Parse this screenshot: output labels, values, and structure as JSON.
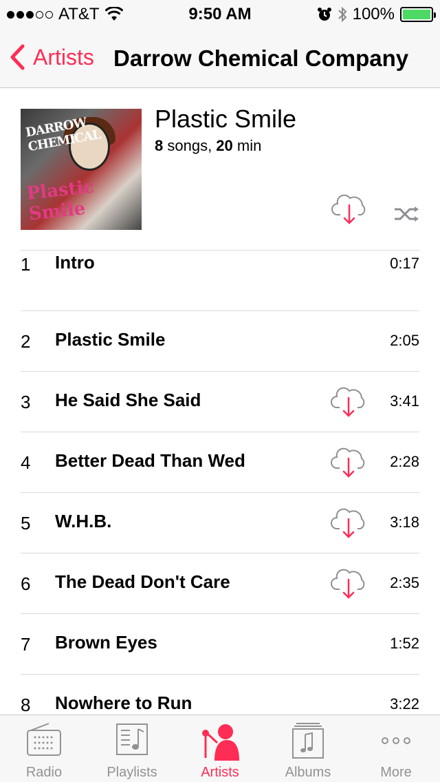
{
  "status_bar": {
    "carrier": "AT&T",
    "time": "9:50 AM",
    "battery": "100%",
    "signal_bars_filled": 3,
    "signal_bars_total": 5
  },
  "nav": {
    "back_label": "Artists",
    "title": "Darrow Chemical Company"
  },
  "album": {
    "art_text_top": "DARROW CHEMICAL COMPANY",
    "art_text_bottom": "Plastic Smile",
    "title": "Plastic Smile",
    "song_count": "8",
    "song_word": " songs, ",
    "minutes": "20",
    "minutes_word": " min"
  },
  "tracks": [
    {
      "number": "1",
      "title": "Intro",
      "duration": "0:17",
      "cloud": false
    },
    {
      "number": "2",
      "title": "Plastic Smile",
      "duration": "2:05",
      "cloud": false
    },
    {
      "number": "3",
      "title": "He Said She Said",
      "duration": "3:41",
      "cloud": true
    },
    {
      "number": "4",
      "title": "Better Dead Than Wed",
      "duration": "2:28",
      "cloud": true
    },
    {
      "number": "5",
      "title": "W.H.B.",
      "duration": "3:18",
      "cloud": true
    },
    {
      "number": "6",
      "title": "The Dead Don't Care",
      "duration": "2:35",
      "cloud": true
    },
    {
      "number": "7",
      "title": "Brown Eyes",
      "duration": "1:52",
      "cloud": false
    },
    {
      "number": "8",
      "title": "Nowhere to Run",
      "duration": "3:22",
      "cloud": false
    }
  ],
  "tab_bar": {
    "tabs": [
      {
        "label": "Radio",
        "icon": "radio-icon",
        "active": false
      },
      {
        "label": "Playlists",
        "icon": "playlists-icon",
        "active": false
      },
      {
        "label": "Artists",
        "icon": "artists-icon",
        "active": true
      },
      {
        "label": "Albums",
        "icon": "albums-icon",
        "active": false
      },
      {
        "label": "More",
        "icon": "more-icon",
        "active": false
      }
    ]
  },
  "colors": {
    "accent": "#ff2d55",
    "battery": "#4cd964",
    "inactive_tab": "#929292"
  }
}
